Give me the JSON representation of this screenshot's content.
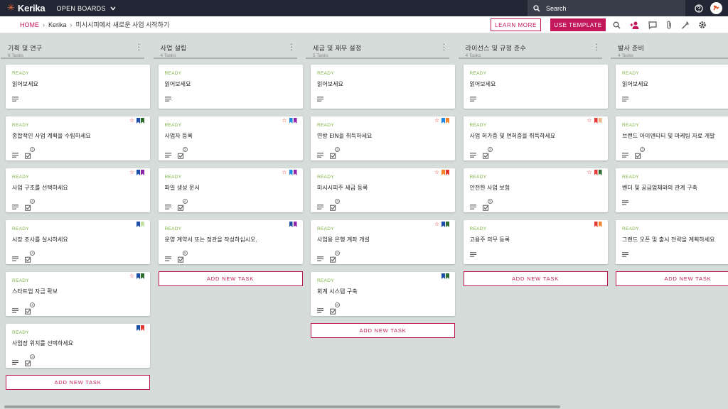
{
  "app": {
    "logo_text": "Kerika",
    "open_boards": "OPEN BOARDS"
  },
  "search": {
    "placeholder": "Search"
  },
  "breadcrumb": {
    "home": "HOME",
    "org": "Kerika",
    "board": "미시시피에서 새로운 사업 시작하기"
  },
  "toolbar": {
    "learn_more": "LEARN MORE",
    "use_template": "USE TEMPLATE"
  },
  "add_task_label": "ADD NEW TASK",
  "colors": {
    "accent": "#c2185b",
    "topbar": "#232634",
    "ready": "#7cb342",
    "board_bg": "#d5dcd9"
  },
  "columns": [
    {
      "title": "기획 및 연구",
      "count": "6 Tasks",
      "cards": [
        {
          "status": "READY",
          "title": "읽어보세요",
          "star": false,
          "flags": [],
          "checklist": ""
        },
        {
          "status": "READY",
          "title": "종합적인 사업 계획을 수립하세요",
          "star": true,
          "flags": [
            "#1e4fa8",
            "#2e6b2e"
          ],
          "checklist": "4"
        },
        {
          "status": "READY",
          "title": "사업 구조를 선택하세요",
          "star": true,
          "flags": [
            "#1e4fa8",
            "#8e24aa"
          ],
          "checklist": "4"
        },
        {
          "status": "READY",
          "title": "시장 조사를 실시하세요",
          "star": false,
          "flags": [
            "#1e4fa8",
            "#c5e1a5"
          ],
          "checklist": "3"
        },
        {
          "status": "READY",
          "title": "스타트업 자금 확보",
          "star": true,
          "flags": [
            "#1e4fa8",
            "#2e6b2e"
          ],
          "checklist": "4"
        },
        {
          "status": "READY",
          "title": "사업장 위치를 선택하세요",
          "star": false,
          "flags": [
            "#1e4fa8",
            "#e53935"
          ],
          "checklist": "3"
        }
      ]
    },
    {
      "title": "사업 설립",
      "count": "4 Tasks",
      "cards": [
        {
          "status": "READY",
          "title": "읽어보세요",
          "star": false,
          "flags": [],
          "checklist": ""
        },
        {
          "status": "READY",
          "title": "사업자 등록",
          "star": true,
          "flags": [
            "#1e88e5",
            "#8e24aa"
          ],
          "checklist": "3"
        },
        {
          "status": "READY",
          "title": "파일 생성 문서",
          "star": true,
          "flags": [
            "#1e88e5",
            "#8e24aa"
          ],
          "checklist": "4"
        },
        {
          "status": "READY",
          "title": "운영 계약서 또는 정관을 작성하십시오.",
          "star": false,
          "flags": [
            "#1e4fa8",
            "#8e24aa"
          ],
          "checklist": "3"
        }
      ]
    },
    {
      "title": "세금 및 재무 설정",
      "count": "5 Tasks",
      "cards": [
        {
          "status": "READY",
          "title": "읽어보세요",
          "star": false,
          "flags": [],
          "checklist": ""
        },
        {
          "status": "READY",
          "title": "연방 EIN을 취득하세요",
          "star": true,
          "flags": [
            "#1e88e5",
            "#f4842b"
          ],
          "checklist": "2"
        },
        {
          "status": "READY",
          "title": "미시시피주 세금 등록",
          "star": true,
          "flags": [
            "#f4842b",
            "#e53935"
          ],
          "checklist": "3"
        },
        {
          "status": "READY",
          "title": "사업용 은행 계좌 개설",
          "star": true,
          "flags": [
            "#1e4fa8",
            "#2e6b2e"
          ],
          "checklist": "3"
        },
        {
          "status": "READY",
          "title": "회계 시스템 구축",
          "star": false,
          "flags": [
            "#1e4fa8",
            "#2e6b2e"
          ],
          "checklist": "3"
        }
      ]
    },
    {
      "title": "라이선스 및 규정 준수",
      "count": "4 Tasks",
      "cards": [
        {
          "status": "READY",
          "title": "읽어보세요",
          "star": false,
          "flags": [],
          "checklist": ""
        },
        {
          "status": "READY",
          "title": "사업 허가증 및 면허증을 취득하세요",
          "star": true,
          "flags": [
            "#e53935",
            "#f4b183"
          ],
          "checklist": "3"
        },
        {
          "status": "READY",
          "title": "안전한 사업 보험",
          "star": true,
          "flags": [
            "#e53935",
            "#2e6b2e"
          ],
          "checklist": "3"
        },
        {
          "status": "READY",
          "title": "고용주 의무 등록",
          "star": false,
          "flags": [
            "#e53935",
            "#f4842b"
          ],
          "checklist": ""
        }
      ]
    },
    {
      "title": "발사 준비",
      "count": "4 Tasks",
      "cards": [
        {
          "status": "READY",
          "title": "읽어보세요",
          "star": false,
          "flags": [],
          "checklist": ""
        },
        {
          "status": "READY",
          "title": "브랜드 아이덴티티 및 마케팅 자료 개발",
          "star": false,
          "flags": [],
          "checklist": "3"
        },
        {
          "status": "READY",
          "title": "벤더 및 공급업체와의 관계 구축",
          "star": false,
          "flags": [],
          "checklist": ""
        },
        {
          "status": "READY",
          "title": "그랜드 오픈 및 출시 전략을 계획하세요",
          "star": false,
          "flags": [],
          "checklist": ""
        }
      ]
    }
  ]
}
